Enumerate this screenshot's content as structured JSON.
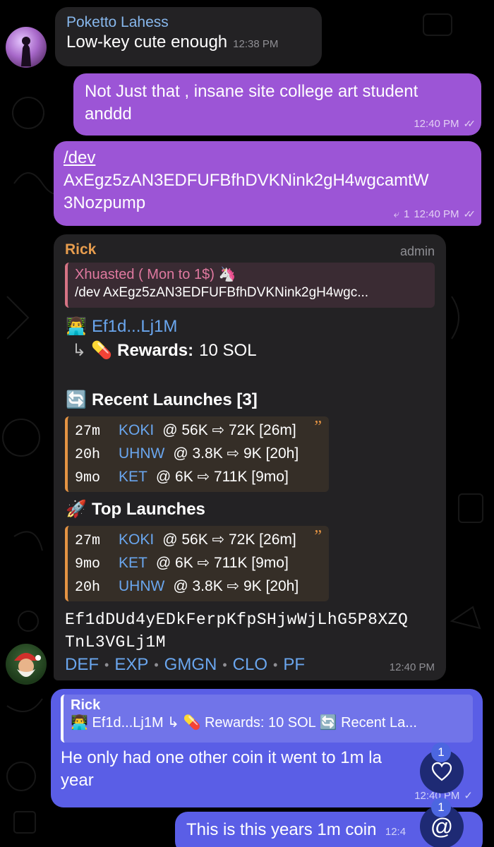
{
  "messages": {
    "msg1": {
      "sender": "Poketto Lahess",
      "text": "Low-key cute enough",
      "time": "12:38 PM"
    },
    "msg2": {
      "text_line1": "Not Just that , insane site college art student",
      "text_line2": "anddd",
      "time": "12:40 PM"
    },
    "msg3": {
      "line1": "/dev",
      "line2": "AxEgz5zAN3EDFUFBfhDVKNink2gH4wgcamtW",
      "line3": "3Nozpump",
      "reply_count": "1",
      "time": "12:40 PM"
    },
    "msg4": {
      "sender": "Rick",
      "role": "admin",
      "quote_title": "Xhuasted ( Mon to 1$) 🦄",
      "quote_text": "/dev AxEgz5zAN3EDFUFBfhDVKNink2gH4wgc...",
      "wallet": "Ef1d...Lj1M",
      "rewards_label": "Rewards:",
      "rewards_value": "10 SOL",
      "recent_title": "Recent Launches [3]",
      "recent": [
        {
          "age": "27m",
          "token": "KOKI",
          "rest": "@ 56K ⇨ 72K [26m]"
        },
        {
          "age": "20h",
          "token": "UHNW",
          "rest": "@ 3.8K ⇨ 9K [20h]"
        },
        {
          "age": "9mo",
          "token": "KET",
          "rest": "@ 6K ⇨ 711K [9mo]"
        }
      ],
      "top_title": "Top Launches",
      "top": [
        {
          "age": "27m",
          "token": "KOKI",
          "rest": "@ 56K ⇨ 72K [26m]"
        },
        {
          "age": "9mo",
          "token": "KET",
          "rest": "@ 6K ⇨ 711K [9mo]"
        },
        {
          "age": "20h",
          "token": "UHNW",
          "rest": "@ 3.8K ⇨ 9K [20h]"
        }
      ],
      "address_line1": "Ef1dDUd4yEDkFerpKfpSHjwWjLhG5P8XZQ",
      "address_line2": "TnL3VGLj1M",
      "links": [
        "DEF",
        "EXP",
        "GMGN",
        "CLO",
        "PF"
      ],
      "link_sep": "•",
      "time": "12:40 PM"
    },
    "msg5": {
      "quote_name": "Rick",
      "quote_text": "👨‍💻 Ef1d...Lj1M ↳ 💊 Rewards: 10 SOL 🔄 Recent La...",
      "text_line1": "He only had one other coin it went to 1m la",
      "text_line2": "year",
      "time": "12:40 PM"
    },
    "msg6": {
      "text": "This is this years 1m coin",
      "time": "12:4"
    }
  },
  "fabs": {
    "reactions_badge": "1",
    "reactions_icon": "heart-icon",
    "mentions_badge": "1",
    "mentions_icon": "@"
  },
  "icons": {
    "hacker": "👨‍💻",
    "pill": "💊",
    "arrow_turn": "↳",
    "refresh": "🔄",
    "rocket": "🚀",
    "quote_mark": "”",
    "reply_arrow": "⤶",
    "check_double": "✓✓",
    "check": "✓"
  },
  "colors": {
    "outgoing_purple": "#9c55d6",
    "outgoing_blue": "#5a5ee6",
    "incoming": "#232224",
    "link": "#6aa6ee",
    "sender_orange": "#e79d4e",
    "sender_blue": "#87b7ec"
  }
}
